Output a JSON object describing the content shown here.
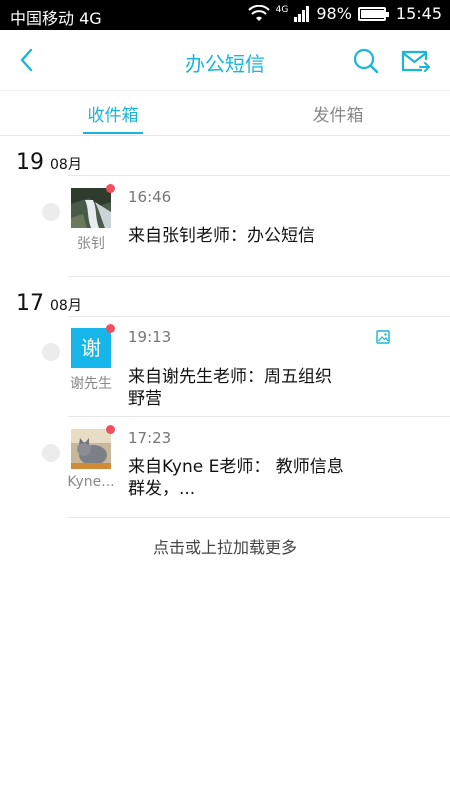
{
  "status_bar": {
    "carrier": "中国移动 4G",
    "network": "4G",
    "battery_percent": "98%",
    "battery_level": 0.98,
    "time": "15:45"
  },
  "header": {
    "title": "办公短信",
    "icons": [
      "back-arrow-icon",
      "search-icon",
      "compose-mail-icon"
    ],
    "accent_color": "#1ab5d8"
  },
  "tabs": {
    "inbox": "收件箱",
    "outbox": "发件箱",
    "active": "inbox"
  },
  "groups": [
    {
      "day": "19",
      "month": "08月",
      "messages": [
        {
          "sender": "张钊",
          "time": "16:46",
          "subject": "来自张钊老师：办公短信",
          "unread": true,
          "avatar": "photo-waterfall",
          "attachment": false
        }
      ]
    },
    {
      "day": "17",
      "month": "08月",
      "messages": [
        {
          "sender": "谢先生",
          "avatar_text": "谢",
          "time": "19:13",
          "subject": "来自谢先生老师：周五组织野营",
          "unread": true,
          "avatar": "text",
          "attachment": true
        },
        {
          "sender": "Kyne...",
          "time": "17:23",
          "subject": "来自Kyne E老师：  教师信息群发，...",
          "unread": true,
          "avatar": "photo-cat",
          "attachment": false
        }
      ]
    }
  ],
  "load_more": "点击或上拉加载更多"
}
